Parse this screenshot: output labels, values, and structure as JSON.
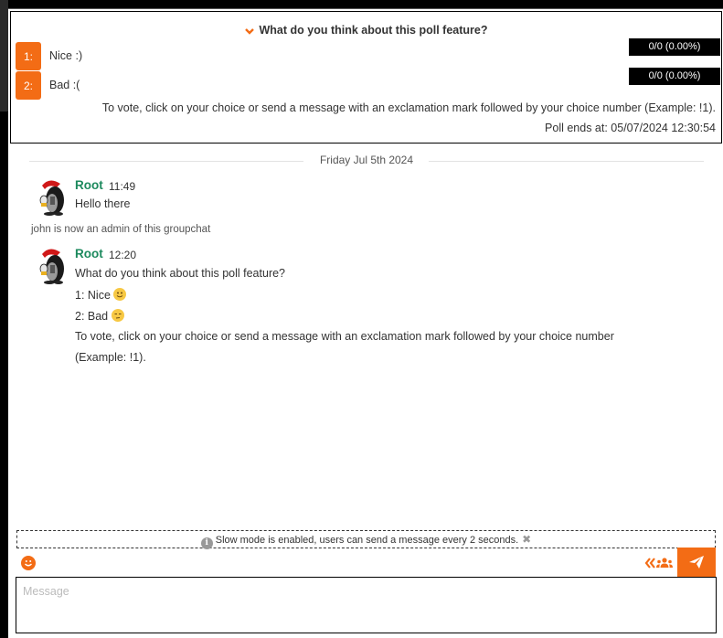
{
  "poll": {
    "question": "What do you think about this poll feature?",
    "collapse_icon": "chevron-down-icon",
    "choices": [
      {
        "number": "1:",
        "label": "Nice :)",
        "result": "0/0 (0.00%)",
        "votes": 0,
        "total": 0,
        "percent": 0.0
      },
      {
        "number": "2:",
        "label": "Bad :(",
        "result": "0/0 (0.00%)",
        "votes": 0,
        "total": 0,
        "percent": 0.0
      }
    ],
    "instructions": "To vote, click on your choice or send a message with an exclamation mark followed by your choice number (Example: !1).",
    "ends_at": "Poll ends at: 05/07/2024 12:30:54"
  },
  "date_separator": "Friday Jul 5th 2024",
  "messages": [
    {
      "author": "Root",
      "time": "11:49",
      "lines": [
        "Hello there"
      ]
    },
    {
      "author": "Root",
      "time": "12:20",
      "lines": [
        "What do you think about this poll feature?",
        "1: Nice",
        "2: Bad",
        "To vote, click on your choice or send a message with an exclamation mark followed by your choice number",
        "(Example: !1)."
      ],
      "emojis": {
        "line1": "slightly-smiling-face",
        "line2": "unamused-face"
      }
    }
  ],
  "system_message": "john is now an admin of this groupchat",
  "slow_mode": {
    "text": "Slow mode is enabled, users can send a message every 2 seconds.",
    "close_glyph": "✖"
  },
  "composer": {
    "placeholder": "Message",
    "value": ""
  },
  "colors": {
    "accent": "#f36c15",
    "author": "#1d8a5e",
    "result_bg": "#000000"
  }
}
